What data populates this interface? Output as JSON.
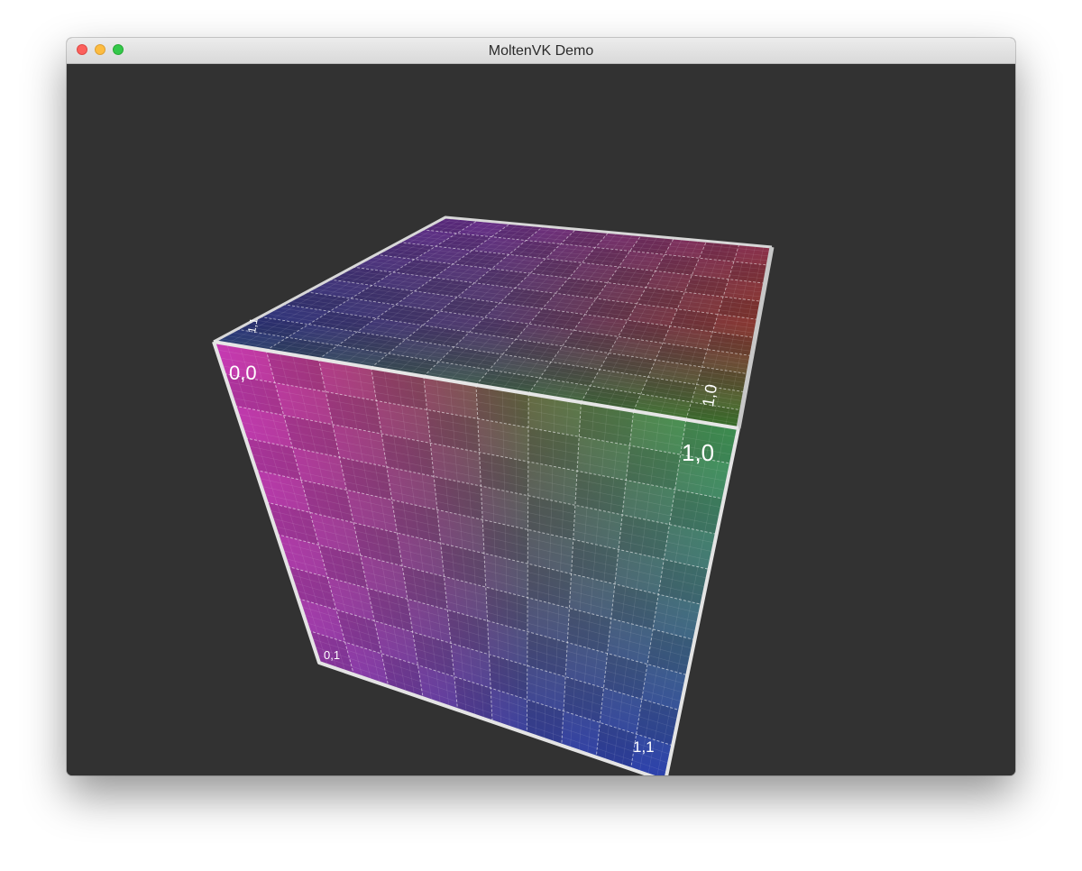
{
  "window": {
    "title": "MoltenVK Demo"
  },
  "cube": {
    "face_corner_labels": {
      "front_top_left": "0,0",
      "front_top_right": "1,0",
      "front_bottom_left": "0,1",
      "front_bottom_right": "1,1",
      "top_far_right": "1,0",
      "top_near_left": "1,1"
    },
    "colors": {
      "red": "#c02828",
      "green": "#40b040",
      "blue": "#2030a8",
      "magenta": "#c040c0",
      "purple": "#7a2a9a",
      "dark": "#323232"
    }
  }
}
